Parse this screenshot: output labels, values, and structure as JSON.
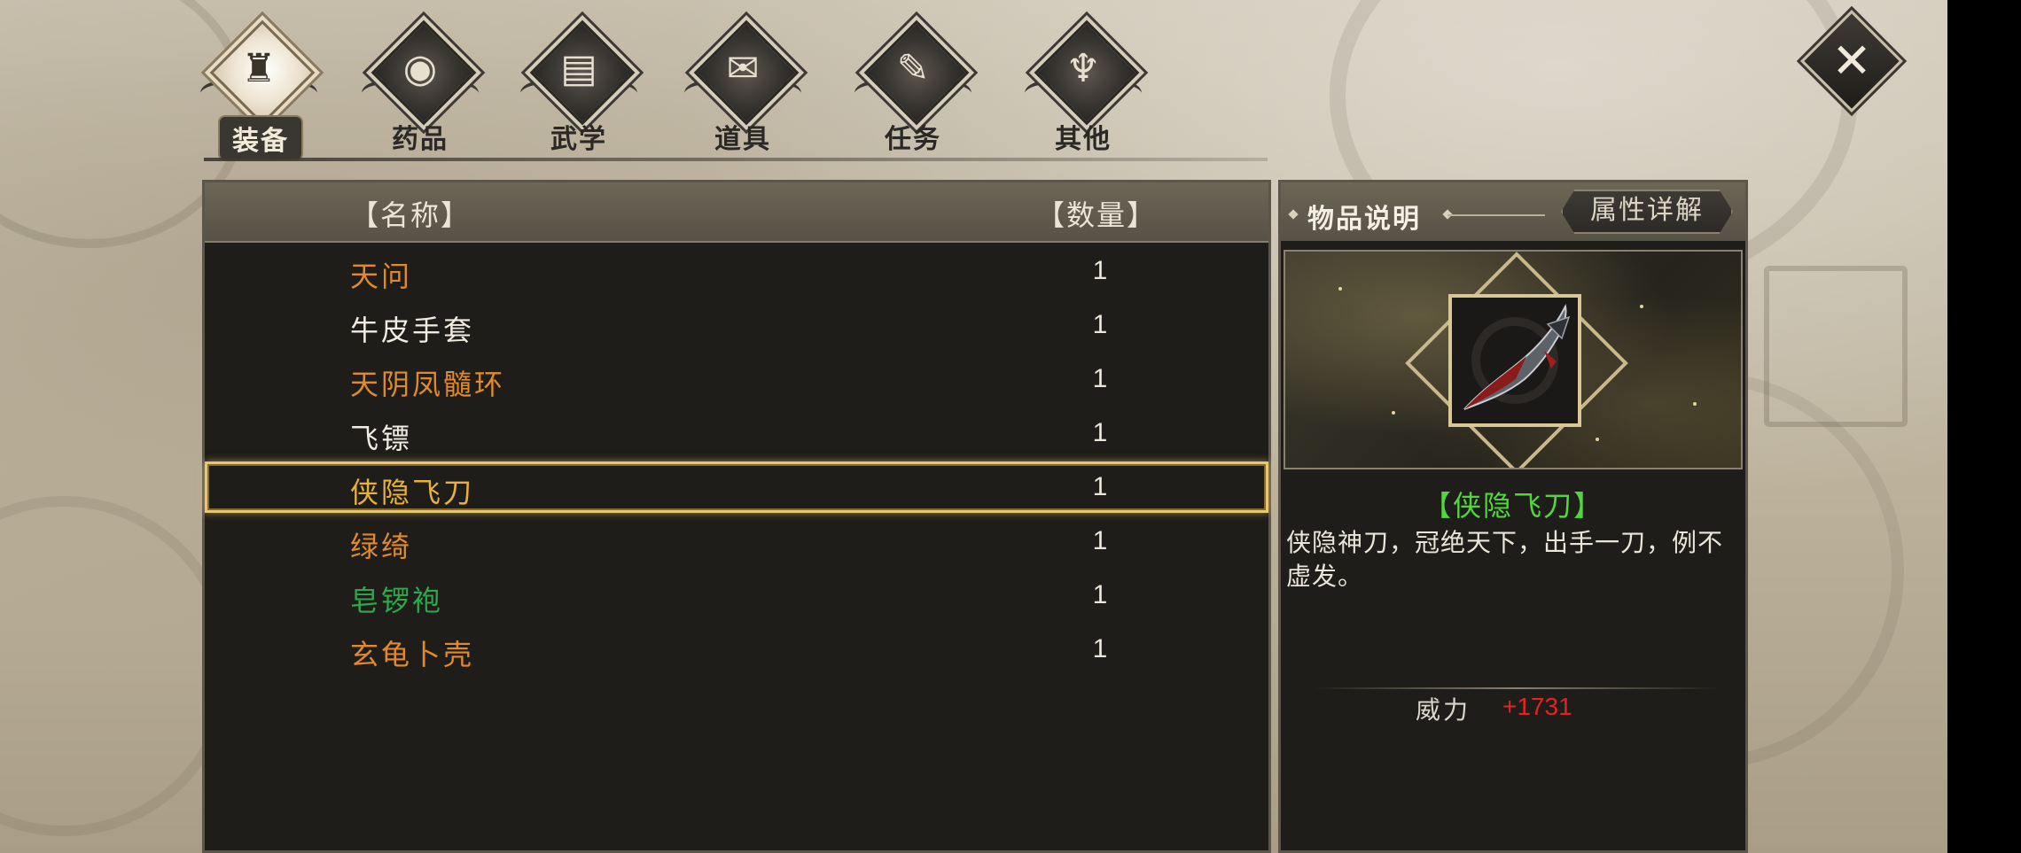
{
  "tabs": [
    {
      "label": "装备",
      "icon": "equipment-icon",
      "active": true
    },
    {
      "label": "药品",
      "icon": "medicine-icon",
      "active": false
    },
    {
      "label": "武学",
      "icon": "martial-arts-icon",
      "active": false
    },
    {
      "label": "道具",
      "icon": "props-icon",
      "active": false
    },
    {
      "label": "任务",
      "icon": "quest-scroll-icon",
      "active": false
    },
    {
      "label": "其他",
      "icon": "other-icon",
      "active": false
    }
  ],
  "list": {
    "name_header": "【名称】",
    "qty_header": "【数量】",
    "items": [
      {
        "name": "天问",
        "qty": "1",
        "color": "#e08a2c"
      },
      {
        "name": "牛皮手套",
        "qty": "1",
        "color": "#f0ece2"
      },
      {
        "name": "天阴凤髓环",
        "qty": "1",
        "color": "#e08a2c"
      },
      {
        "name": "飞镖",
        "qty": "1",
        "color": "#f0ece2"
      },
      {
        "name": "侠隐飞刀",
        "qty": "1",
        "color": "#e8b23a",
        "selected": true
      },
      {
        "name": "绿绮",
        "qty": "1",
        "color": "#e08a2c"
      },
      {
        "name": "皂锣袍",
        "qty": "1",
        "color": "#2ea84a"
      },
      {
        "name": "玄龟卜壳",
        "qty": "1",
        "color": "#e08a2c"
      }
    ]
  },
  "detail": {
    "tab_desc": "物品说明",
    "tab_attr": "属性详解",
    "item_icon": "throwing-knife-icon",
    "item_name": "【侠隐飞刀】",
    "description": "侠隐神刀，冠绝天下，出手一刀，例不虚发。",
    "stat_label": "威力",
    "stat_value": "+1731",
    "stat_value_color": "#e52222",
    "name_color": "#53d63c"
  },
  "close_icon": "close-icon"
}
